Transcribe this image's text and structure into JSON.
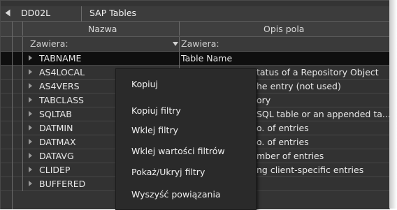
{
  "header": {
    "table_name": "DD02L",
    "table_desc": "SAP Tables"
  },
  "columns": {
    "name": "Nazwa",
    "description": "Opis pola"
  },
  "filters": {
    "name_filter": "Zawiera:",
    "description_filter": "Zawiera:"
  },
  "rows": [
    {
      "name": "TABNAME",
      "description": "Table Name"
    },
    {
      "name": "AS4LOCAL",
      "description": "tatus of a Repository Object"
    },
    {
      "name": "AS4VERS",
      "description": "he entry (not used)"
    },
    {
      "name": "TABCLASS",
      "description": "ory"
    },
    {
      "name": "SQLTAB",
      "description": "SQL table or an appended ta..."
    },
    {
      "name": "DATMIN",
      "description": "o. of entries"
    },
    {
      "name": "DATMAX",
      "description": "o. of entries"
    },
    {
      "name": "DATAVG",
      "description": "mber of entries"
    },
    {
      "name": "CLIDEP",
      "description": "ng client-specific entries"
    },
    {
      "name": "BUFFERED",
      "description": ""
    }
  ],
  "context_menu": {
    "copy": "Kopiuj",
    "copy_filters": "Kopiuj filtry",
    "paste_filters": "Wklej filtry",
    "paste_filter_values": "Wklej wartości filtrów",
    "toggle_filters": "Pokaż/Ukryj filtry",
    "clear_relations": "Wyszyść powiązania"
  },
  "colors": {
    "background": "#343434",
    "selected_row": "#0f0f0f",
    "menu": "#2a2a2a"
  }
}
